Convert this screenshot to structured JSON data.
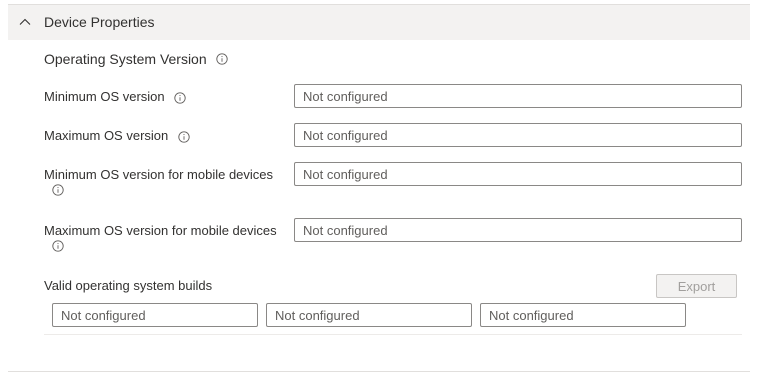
{
  "section": {
    "title": "Device Properties",
    "expanded": true,
    "chevron_icon": "chevron-up-icon"
  },
  "group": {
    "title": "Operating System Version",
    "info_icon": "info-icon"
  },
  "fields": [
    {
      "label": "Minimum OS version",
      "placeholder": "Not configured"
    },
    {
      "label": "Maximum OS version",
      "placeholder": "Not configured"
    },
    {
      "label": "Minimum OS version for mobile devices",
      "placeholder": "Not configured"
    },
    {
      "label": "Maximum OS version for mobile devices",
      "placeholder": "Not configured"
    }
  ],
  "builds": {
    "label": "Valid operating system builds",
    "export_label": "Export",
    "export_enabled": false,
    "inputs": [
      {
        "placeholder": "Not configured"
      },
      {
        "placeholder": "Not configured"
      },
      {
        "placeholder": "Not configured"
      }
    ]
  },
  "colors": {
    "header_background": "#f3f2f1",
    "border": "#8a8886",
    "text": "#323130",
    "placeholder": "#605e5c",
    "disabled_text": "#a19f9d"
  }
}
